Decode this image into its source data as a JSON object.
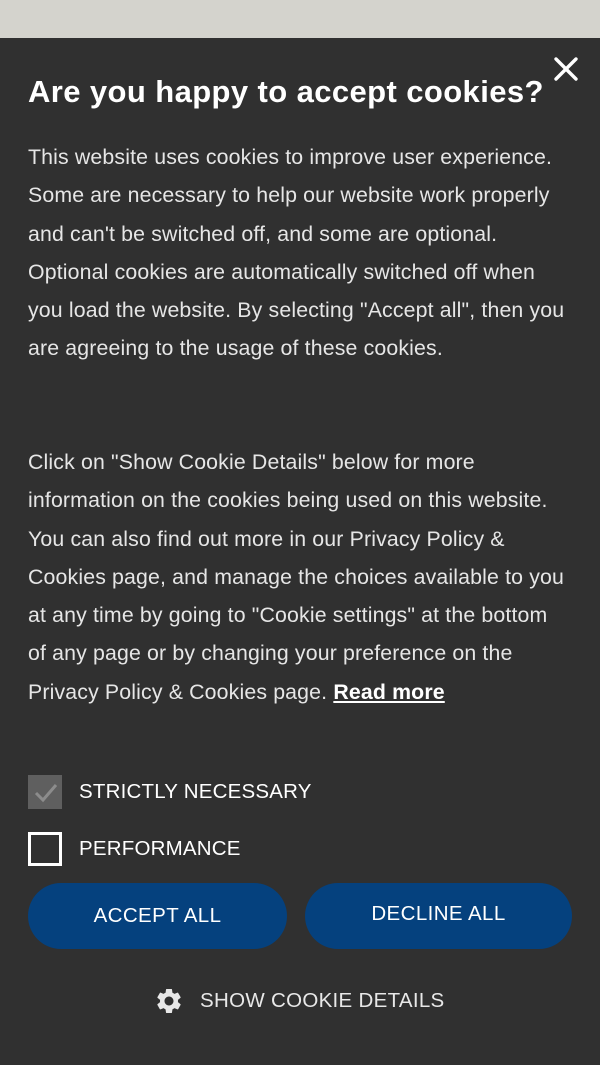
{
  "dialog": {
    "title": "Are you happy to accept cookies?",
    "close_icon": "close-icon",
    "paragraph1": "This website uses cookies to improve user experience. Some are necessary to help our website work properly and can't be switched off, and some are optional. Optional cookies are automatically switched off when you load the website. By selecting \"Accept all\", then you are agreeing to the usage of these cookies.",
    "paragraph2": "Click on \"Show Cookie Details\" below for more information on the cookies being used on this website. You can also find out more in our Privacy Policy & Cookies page, and manage the choices available to you at any time by going to \"Cookie settings\" at the bottom of any page or by changing your preference on the Privacy Policy & Cookies page.",
    "read_more": "Read more"
  },
  "options": [
    {
      "label": "STRICTLY NECESSARY",
      "checked": true,
      "disabled": true
    },
    {
      "label": "PERFORMANCE",
      "checked": false,
      "disabled": false
    }
  ],
  "buttons": {
    "accept_all": "ACCEPT ALL",
    "decline_all": "DECLINE ALL"
  },
  "details": {
    "label": "SHOW COOKIE DETAILS",
    "icon": "gear-icon"
  },
  "colors": {
    "dialog_bg": "#303030",
    "button_bg": "#05417e",
    "page_bg": "#d4d3cd"
  }
}
